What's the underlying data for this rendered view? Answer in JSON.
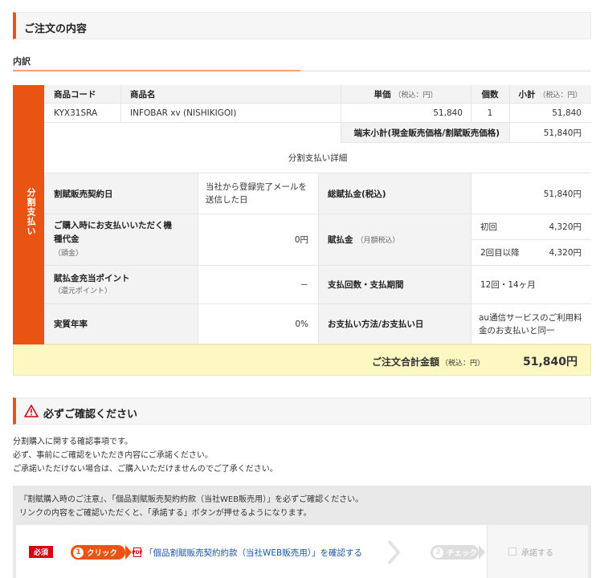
{
  "order_section": {
    "title": "ご注文の内容"
  },
  "breakdown": {
    "title": "内訳"
  },
  "side_label": "分割支払い",
  "item_table": {
    "headers": {
      "code": "商品コード",
      "name": "商品名",
      "price": "単価",
      "price_note": "（税込：円）",
      "qty": "個数",
      "subtotal": "小計",
      "subtotal_note": "（税込：円）"
    },
    "row": {
      "code": "KYX31SRA",
      "name": "INFOBAR xv (NISHIKIGOI)",
      "price": "51,840",
      "qty": "1",
      "subtotal": "51,840"
    },
    "terminal_subtotal_label": "端末小計(現金販売価格/割賦販売価格)",
    "terminal_subtotal_value": "51,840円"
  },
  "installment": {
    "title": "分割支払い詳細",
    "contract_date_label": "割賦販売契約日",
    "contract_date_value": "当社から登録完了メールを送信した日",
    "total_label": "総賦払金(税込)",
    "total_value": "51,840円",
    "down_payment_label": "ご購入時にお支払いいただく機種代金",
    "down_payment_note": "（頭金）",
    "down_payment_value": "0円",
    "installment_label": "賦払金",
    "installment_note": "（月額税込）",
    "first_label": "初回",
    "first_value": "4,320円",
    "second_label": "2回目以降",
    "second_value": "4,320円",
    "points_label": "賦払金充当ポイント",
    "points_note": "（還元ポイント）",
    "points_value": "－",
    "count_label": "支払回数・支払期間",
    "count_value": "12回・14ヶ月",
    "rate_label": "実質年率",
    "rate_value": "0%",
    "method_label": "お支払い方法/お支払い日",
    "method_value": "au通信サービスのご利用料金のお支払いと同一"
  },
  "total": {
    "label": "ご注文合計金額",
    "note": "（税込：円）",
    "value": "51,840円"
  },
  "confirm_section": {
    "title": "必ずご確認ください"
  },
  "notes": [
    "分割購入に関する確認事項です。",
    "必ず、事前にご確認をいただき内容にご承諾ください。",
    "ご承諾いただけない場合は、ご購入いただけませんのでご了承ください。"
  ],
  "confirm_box": {
    "line1": "『割賦購入時のご注意』、「個品割賦販売契約約款（当社WEB販売用）」を必ずご確認ください。",
    "line2": "リンクの内容をご確認いただくと、「承諾する」ボタンが押せるようになります。",
    "required_badge": "必須",
    "step1_num": "1",
    "step1_label": "クリック",
    "pdf_icon_text": "PDF",
    "link_text": "「個品割賦販売契約約款（当社WEB販売用）」を確認する",
    "step2_num": "2",
    "step2_label": "チェック",
    "approve_label": "承諾する"
  },
  "colors": {
    "accent": "#ea5413",
    "total_bg": "#fdf7c2",
    "link": "#1a55a5",
    "required": "#d7000f"
  }
}
